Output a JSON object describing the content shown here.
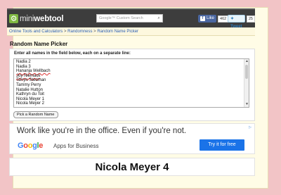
{
  "header": {
    "logo": {
      "icon": "gear-icon",
      "mini": "mini",
      "webtool": "webtool"
    },
    "search_placeholder": "Google™ Custom Search",
    "facebook": {
      "label": "Like",
      "count": "462"
    },
    "twitter": {
      "label": "Tweet",
      "count": "25"
    }
  },
  "breadcrumb": {
    "items": [
      "Online Tools and Calculators",
      "Randomness",
      "Random Name Picker"
    ],
    "separator": ">"
  },
  "main": {
    "title": "Random Name Picker",
    "instruction": "Enter all names in the field below, each on a separate line:",
    "names": [
      "Nadia 2",
      "Nadia 3",
      "Hananja Wellbach",
      "Joy Niemack",
      "Tarryn Stedman",
      "Tammy Perry",
      "Natalie Hutton",
      "Kathryn du Toit",
      "Nicola Meyer 1",
      "Nicola Meyer 2"
    ],
    "pick_button": "Pick a Random Name"
  },
  "ad": {
    "headline": "Work like you're in the office. Even if you're not.",
    "google": "Google",
    "product": "Apps for Business",
    "cta": "Try it for free",
    "info_icon": "ad-choices-icon"
  },
  "result": {
    "name": "Nicola Meyer 4"
  },
  "colors": {
    "page_background": "#f2c4c6",
    "header": "#3d3d3d",
    "link": "#2b5fb3",
    "cta": "#1a73e8"
  }
}
